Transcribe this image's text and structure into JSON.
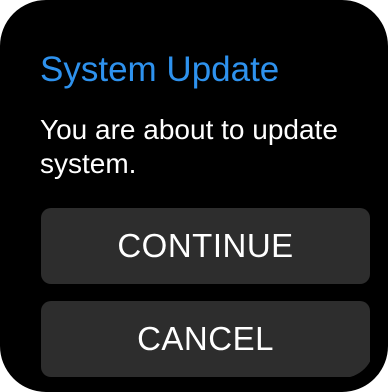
{
  "dialog": {
    "title": "System Update",
    "message": "You are about to update system.",
    "continue_label": "CONTINUE",
    "cancel_label": "CANCEL"
  },
  "colors": {
    "background": "#000000",
    "title": "#2e92ee",
    "text": "#ffffff",
    "button": "#2d2d2d"
  }
}
